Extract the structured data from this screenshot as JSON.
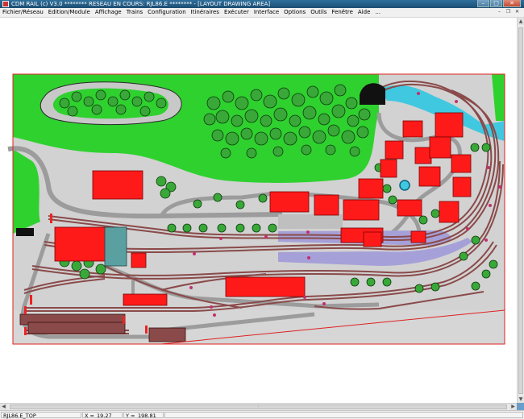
{
  "window": {
    "title": "CDM RAIL (c) V3.0      ******** RESEAU EN COURS: RJL86.E ******** - [LAYOUT DRAWING AREA]",
    "minimize_glyph": "–",
    "maximize_glyph": "□",
    "close_glyph": "✕"
  },
  "menu": {
    "items": [
      {
        "label": "Fichier/Réseau"
      },
      {
        "label": "Edition/Module"
      },
      {
        "label": "Affichage"
      },
      {
        "label": "Trains"
      },
      {
        "label": "Configuration"
      },
      {
        "label": "Itinéraires"
      },
      {
        "label": "Exécuter"
      },
      {
        "label": "Interface"
      },
      {
        "label": "Options"
      },
      {
        "label": "Outils"
      },
      {
        "label": "Fenêtre"
      },
      {
        "label": "Aide"
      },
      {
        "label": "..."
      }
    ],
    "mdi_minimize": "–",
    "mdi_restore": "❐",
    "mdi_close": "✕"
  },
  "status": {
    "layer": "RJL86.E_TOP",
    "x_label": "X =",
    "x_value": "19.27",
    "y_label": "Y =",
    "y_value": "198.81"
  },
  "colors": {
    "grass": "#2fd12f",
    "concrete": "#c8c8c8",
    "building_roof": "#ff1a1a",
    "water": "#40c8e0",
    "ballast": "#8a4a4a",
    "platform": "#a6a0d8",
    "border": "#e02020"
  },
  "icons": {
    "app": "cdm-rail-logo-icon",
    "scroll_up": "arrow-up-icon",
    "scroll_down": "arrow-down-icon",
    "scroll_left": "arrow-left-icon",
    "scroll_right": "arrow-right-icon"
  }
}
